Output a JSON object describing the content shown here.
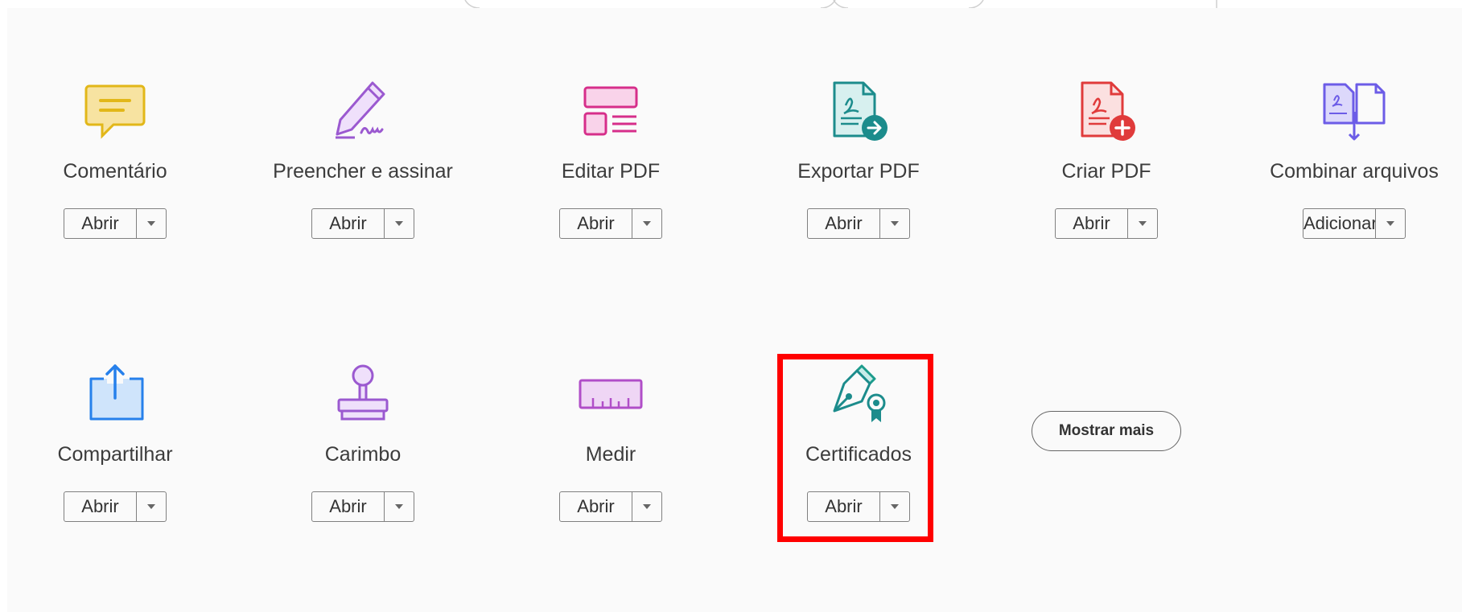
{
  "tools": [
    {
      "label": "Comentário",
      "button": "Abrir",
      "icon": "comment-icon"
    },
    {
      "label": "Preencher e assinar",
      "button": "Abrir",
      "icon": "fill-sign-icon"
    },
    {
      "label": "Editar PDF",
      "button": "Abrir",
      "icon": "edit-pdf-icon"
    },
    {
      "label": "Exportar PDF",
      "button": "Abrir",
      "icon": "export-pdf-icon"
    },
    {
      "label": "Criar PDF",
      "button": "Abrir",
      "icon": "create-pdf-icon"
    },
    {
      "label": "Combinar arquivos",
      "button": "Adicionar",
      "icon": "combine-files-icon"
    },
    {
      "label": "Compartilhar",
      "button": "Abrir",
      "icon": "share-icon"
    },
    {
      "label": "Carimbo",
      "button": "Abrir",
      "icon": "stamp-icon"
    },
    {
      "label": "Medir",
      "button": "Abrir",
      "icon": "measure-icon"
    },
    {
      "label": "Certificados",
      "button": "Abrir",
      "icon": "certificates-icon"
    }
  ],
  "show_more": "Mostrar mais",
  "highlight_color": "#ff0000"
}
